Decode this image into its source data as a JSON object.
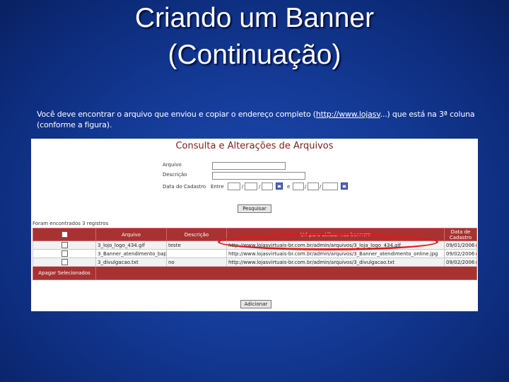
{
  "slide": {
    "title_line1": "Criando um Banner",
    "title_line2": "(Continuação)"
  },
  "instruction": {
    "text_before_link": "Você deve encontrar o arquivo que enviou e copiar o endereço completo (",
    "link_text": "http://www.lojasv",
    "text_after_link": "...) que está na 3ª coluna",
    "line2": "(conforme a figura)."
  },
  "screenshot": {
    "title": "Consulta e Alterações de Arquivos",
    "form": {
      "arquivo_label": "Arquivo",
      "descricao_label": "Descrição",
      "data_label": "Data do Cadastro",
      "entre_label": "Entre",
      "e_label": "e",
      "slash": "/",
      "pesquisar_button": "Pesquisar"
    },
    "found_text": "Foram encontrados 3 registros",
    "table": {
      "headers": [
        "",
        "Arquivo",
        "Descrição",
        "Url para utilizar nos banners",
        "Data de Cadastro"
      ],
      "rows": [
        {
          "arquivo": "3_lojo_logo_434.gif",
          "descricao": "teste",
          "url": "http://www.lojasvirtuais-br.com.br/admin/arquivos/3_loja_logo_434.gif",
          "data": "09/01/2006"
        },
        {
          "arquivo": "3_Banner_atendimento_bapte_dimento_online.html",
          "descricao": "",
          "url": "http://www.lojasvirtuais-br.com.br/admin/arquivos/3_Banner_atendimento_online.jpg",
          "data": "09/02/2006"
        },
        {
          "arquivo": "3_divulgacao.txt",
          "descricao": "no",
          "url": "http://www.lojasvirtuais-br.com.br/admin/arquivos/3_divulgacao.txt",
          "data": "09/02/2006"
        }
      ],
      "footer_label": "Apagar Selecionados"
    },
    "adicionar_button": "Adicionar"
  }
}
